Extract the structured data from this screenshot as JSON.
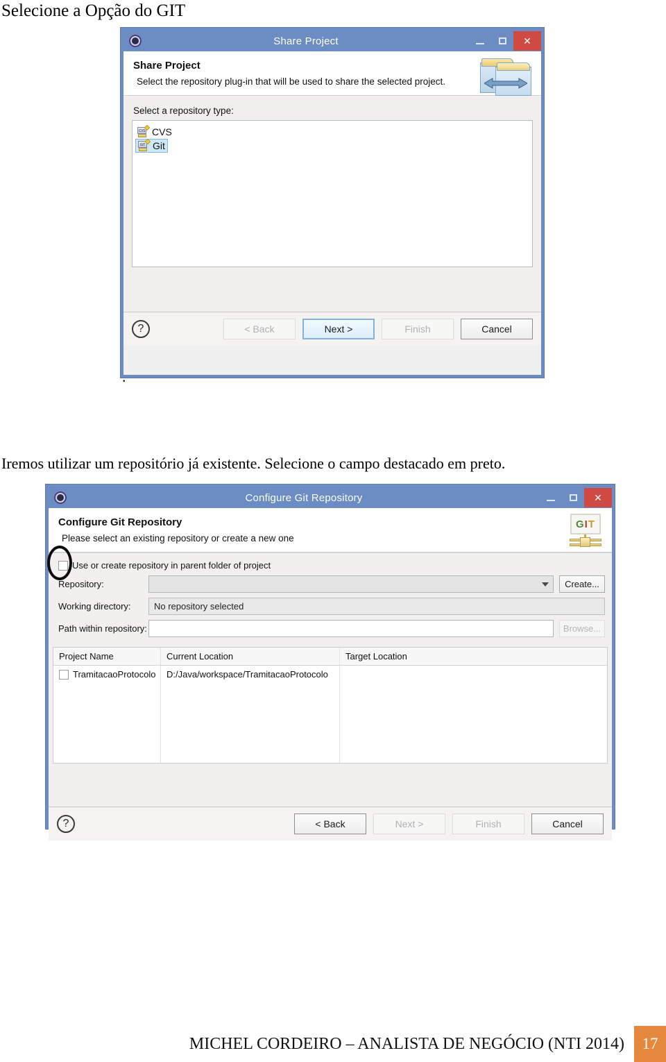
{
  "document": {
    "heading": "Selecione a Opção do GIT",
    "paragraph": "Iremos utilizar um repositório já existente. Selecione o campo destacado em preto.",
    "stray_mark": "."
  },
  "share_project_dialog": {
    "titlebar": {
      "app_icon": "gear-icon",
      "title": "Share Project",
      "minimize_label": "",
      "maximize_label": "",
      "close_label": "✕"
    },
    "header": {
      "title": "Share Project",
      "subtitle": "Select the repository plug-in that will be used to share the selected project.",
      "banner_icon": "shared-folders-icon"
    },
    "repository_type_label": "Select a repository type:",
    "repository_types": [
      {
        "label": "CVS",
        "icon": "cvs-repository-icon",
        "selected": false,
        "icon_text": "CVS"
      },
      {
        "label": "Git",
        "icon": "git-repository-icon",
        "selected": true,
        "icon_text": "GIT"
      }
    ],
    "buttons": {
      "help": "?",
      "back": "< Back",
      "next": "Next >",
      "finish": "Finish",
      "cancel": "Cancel"
    }
  },
  "configure_git_dialog": {
    "titlebar": {
      "app_icon": "gear-icon",
      "title": "Configure Git Repository",
      "close_label": "✕"
    },
    "header": {
      "title": "Configure Git Repository",
      "subtitle": "Please select an existing repository or create a new one",
      "banner_icon": "git-logo-icon"
    },
    "parent_folder_checkbox": {
      "label": "Use or create repository in parent folder of project",
      "checked": false
    },
    "fields": {
      "repository_label": "Repository:",
      "repository_value": "",
      "create_button": "Create...",
      "working_directory_label": "Working directory:",
      "working_directory_value": "No repository selected",
      "path_within_repository_label": "Path within repository:",
      "path_within_repository_value": "",
      "browse_button": "Browse..."
    },
    "table": {
      "columns": [
        "Project Name",
        "Current Location",
        "Target Location"
      ],
      "rows": [
        {
          "checked": false,
          "project_name": "TramitacaoProtocolo",
          "current_location": "D:/Java/workspace/TramitacaoProtocolo",
          "target_location": ""
        }
      ]
    },
    "buttons": {
      "help": "?",
      "back": "< Back",
      "next": "Next >",
      "finish": "Finish",
      "cancel": "Cancel"
    }
  },
  "footer": {
    "text": "MICHEL CORDEIRO – ANALISTA DE NEGÓCIO (NTI 2014)",
    "page_number": "17"
  },
  "colors": {
    "titlebar_blue": "#6c8cc4",
    "close_red": "#cf4a42",
    "selection_blue": "#cfe8f7",
    "footer_orange": "#e5873d",
    "annotation_black": "#0b0b0b"
  }
}
